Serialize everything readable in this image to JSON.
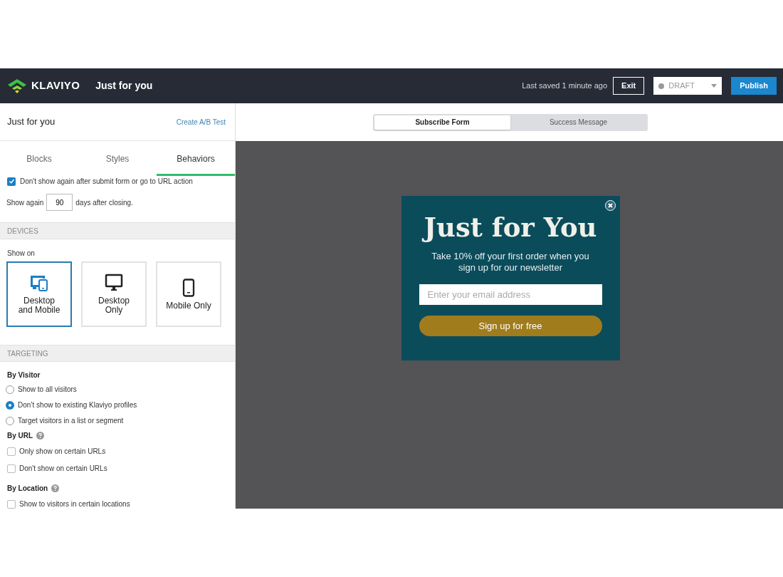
{
  "header": {
    "brand": "KLAVIYO",
    "title": "Just for you",
    "saved": "Last saved 1 minute ago",
    "exit": "Exit",
    "status": "DRAFT",
    "publish": "Publish"
  },
  "panel": {
    "title": "Just for you",
    "ab_link": "Create A/B Test",
    "tabs": [
      {
        "label": "Blocks",
        "selected": false
      },
      {
        "label": "Styles",
        "selected": false
      },
      {
        "label": "Behaviors",
        "selected": true
      }
    ],
    "dont_show": {
      "label": "Don't show again after submit form or go to URL action",
      "checked": true
    },
    "show_again": {
      "before": "Show again",
      "value": "90",
      "after": "days after closing."
    },
    "devices": {
      "heading": "DEVICES",
      "label": "Show on",
      "options": [
        {
          "kind": "both",
          "label": "Desktop and Mobile",
          "selected": true
        },
        {
          "kind": "desktop",
          "label": "Desktop Only",
          "selected": false
        },
        {
          "kind": "mobile",
          "label": "Mobile Only",
          "selected": false
        }
      ]
    },
    "targeting": {
      "heading": "TARGETING",
      "groups": [
        {
          "title": "By Visitor",
          "help": false,
          "kind": "radio",
          "items": [
            {
              "label": "Show to all visitors",
              "selected": false
            },
            {
              "label": "Don’t show to existing Klaviyo profiles",
              "selected": true
            },
            {
              "label": "Target visitors in a list or segment",
              "selected": false
            }
          ]
        },
        {
          "title": "By URL",
          "help": true,
          "kind": "checkbox",
          "items": [
            {
              "label": "Only show on certain URLs",
              "checked": false
            },
            {
              "label": "Don't show on certain URLs",
              "checked": false
            }
          ]
        },
        {
          "title": "By Location",
          "help": true,
          "kind": "checkbox",
          "items": [
            {
              "label": "Show to visitors in certain locations",
              "checked": false
            }
          ]
        }
      ]
    }
  },
  "view_tabs": [
    {
      "label": "Subscribe Form",
      "selected": true
    },
    {
      "label": "Success Message",
      "selected": false
    }
  ],
  "popup": {
    "heading": "Just for You",
    "text": "Take 10% off your first order when you sign up for our newsletter",
    "placeholder": "Enter your email address",
    "button": "Sign up for free"
  }
}
